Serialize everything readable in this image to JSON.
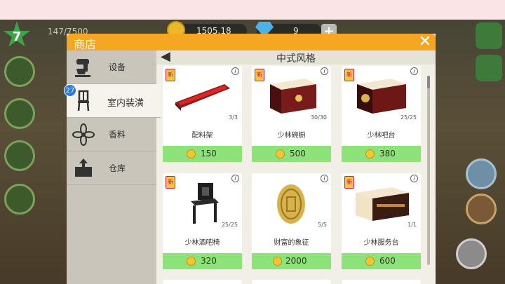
{
  "hud": {
    "level": "7",
    "xp": "147/7500",
    "coins": "1505.18",
    "gems": "9",
    "plus_label": "+"
  },
  "shop": {
    "title": "商店",
    "close_label": "✕",
    "section_title": "中式风格",
    "back_label": "◀"
  },
  "sidebar": {
    "tabs": [
      {
        "label": "设备",
        "icon": "mixer-icon"
      },
      {
        "label": "室内装潢",
        "icon": "chair-icon",
        "badge": "27"
      },
      {
        "label": "香料",
        "icon": "spice-icon"
      },
      {
        "label": "仓库",
        "icon": "box-icon"
      }
    ]
  },
  "items": [
    {
      "name": "配料架",
      "count": "3/3",
      "price": "150",
      "tag": "新",
      "info": "i"
    },
    {
      "name": "少林碗橱",
      "count": "30/30",
      "price": "500",
      "tag": "新",
      "info": "i"
    },
    {
      "name": "少林吧台",
      "count": "25/25",
      "price": "380",
      "tag": "新",
      "info": "i"
    },
    {
      "name": "少林酒吧椅",
      "count": "25/25",
      "price": "320",
      "tag": "新",
      "info": "i"
    },
    {
      "name": "财富的象征",
      "count": "5/5",
      "price": "2000",
      "tag": "",
      "info": "i"
    },
    {
      "name": "少林服务台",
      "count": "1/1",
      "price": "600",
      "tag": "新",
      "info": "i"
    }
  ],
  "colors": {
    "header": "#f5a623",
    "price_bar": "#8ee27a",
    "badge": "#2f78d6"
  }
}
